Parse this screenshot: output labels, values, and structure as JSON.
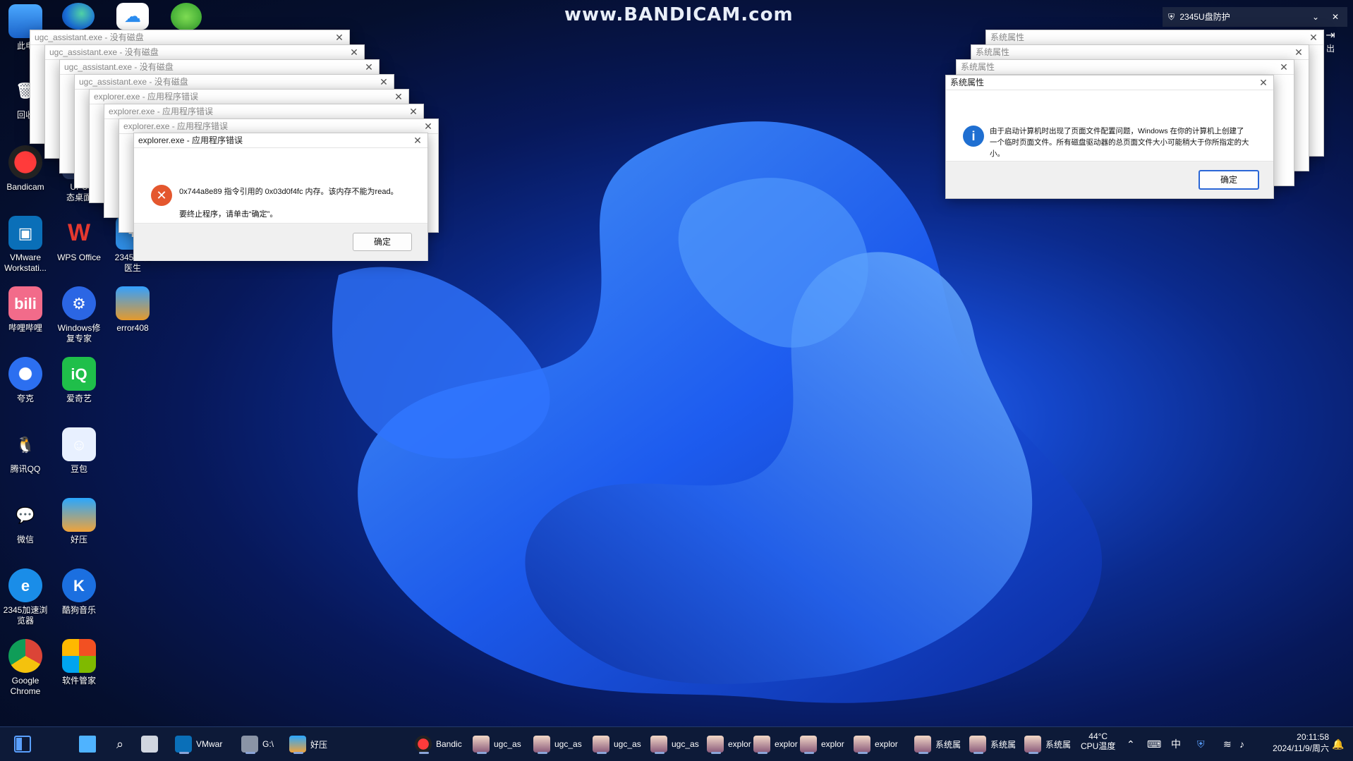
{
  "watermark": "www.BANDICAM.com",
  "colors": {
    "accent": "#2a66d6",
    "error_red": "#e4572e",
    "info_blue": "#1f6fd1",
    "taskbar": "#0d1a38"
  },
  "desktop": {
    "icons": [
      {
        "id": "this-pc",
        "label": "此电",
        "icon": "monitor-icon"
      },
      {
        "id": "recycle",
        "label": "回收",
        "icon": "recycle-bin-icon"
      },
      {
        "id": "bandicam",
        "label": "Bandicam",
        "icon": "record-icon"
      },
      {
        "id": "upupoo",
        "label": "UPU\n态桌面",
        "icon": "upupoo-icon"
      },
      {
        "id": "vmware",
        "label": "VMware\nWorkstati...",
        "icon": "vmware-icon"
      },
      {
        "id": "wps",
        "label": "WPS Office",
        "icon": "wps-icon"
      },
      {
        "id": "2345doctor",
        "label": "2345系统\n医生",
        "icon": "doctor-icon"
      },
      {
        "id": "bilibili",
        "label": "哔哩哔哩",
        "icon": "bilibili-icon"
      },
      {
        "id": "winrepair",
        "label": "Windows修\n复专家",
        "icon": "repair-icon"
      },
      {
        "id": "error408",
        "label": "error408",
        "icon": "archive-icon"
      },
      {
        "id": "quark",
        "label": "夸克",
        "icon": "quark-icon"
      },
      {
        "id": "iqiyi",
        "label": "爱奇艺",
        "icon": "iqiyi-icon"
      },
      {
        "id": "qq",
        "label": "腾讯QQ",
        "icon": "penguin-icon"
      },
      {
        "id": "doubao",
        "label": "豆包",
        "icon": "doubao-icon"
      },
      {
        "id": "wechat",
        "label": "微信",
        "icon": "wechat-icon"
      },
      {
        "id": "haozip",
        "label": "好压",
        "icon": "haozip-icon"
      },
      {
        "id": "2345browser",
        "label": "2345加速浏\n览器",
        "icon": "browser-e-icon"
      },
      {
        "id": "kugou",
        "label": "酷狗音乐",
        "icon": "kugou-icon"
      },
      {
        "id": "chrome",
        "label": "Google\nChrome",
        "icon": "chrome-icon"
      },
      {
        "id": "softmgr",
        "label": "软件管家",
        "icon": "softmgr-icon"
      }
    ],
    "top_icons": [
      "edge-icon",
      "cloud-icon",
      "green-app-icon"
    ]
  },
  "shield_popup": {
    "title": "2345U盘防护",
    "exit_label": "出"
  },
  "stacked_left": [
    "ugc_assistant.exe - 没有磁盘",
    "ugc_assistant.exe - 没有磁盘",
    "ugc_assistant.exe - 没有磁盘",
    "ugc_assistant.exe - 没有磁盘",
    "explorer.exe - 应用程序错误",
    "explorer.exe - 应用程序错误",
    "explorer.exe - 应用程序错误"
  ],
  "error_dialog": {
    "title": "explorer.exe - 应用程序错误",
    "line1": "0x744a8e89 指令引用的 0x03d0f4fc 内存。该内存不能为read。",
    "line2": "要终止程序，请单击“确定”。",
    "ok": "确定"
  },
  "stacked_right": [
    "系统属性",
    "系统属性",
    "系统属性"
  ],
  "sys_dialog": {
    "title": "系统属性",
    "message": "由于启动计算机时出现了页面文件配置问题，Windows 在你的计算机上创建了一个临时页面文件。所有磁盘驱动器的总页面文件大小可能稍大于你所指定的大小。",
    "ok": "确定"
  },
  "taskbar": {
    "items": [
      {
        "label": "",
        "icon": "windows-start-icon"
      },
      {
        "label": "",
        "icon": "search-icon"
      },
      {
        "label": "",
        "icon": "task-view-icon"
      },
      {
        "label": "VMwar",
        "icon": "vmware-icon"
      },
      {
        "label": "G:\\",
        "icon": "drive-icon"
      },
      {
        "label": "好压",
        "icon": "haozip-icon"
      },
      {
        "label": "Bandic",
        "icon": "record-icon"
      },
      {
        "label": "ugc_as",
        "icon": "anime-avatar-icon"
      },
      {
        "label": "ugc_as",
        "icon": "anime-avatar-icon"
      },
      {
        "label": "ugc_as",
        "icon": "anime-avatar-icon"
      },
      {
        "label": "ugc_as",
        "icon": "anime-avatar-icon"
      },
      {
        "label": "explor",
        "icon": "anime-avatar-icon"
      },
      {
        "label": "explor",
        "icon": "anime-avatar-icon"
      },
      {
        "label": "explor",
        "icon": "anime-avatar-icon"
      },
      {
        "label": "explor",
        "icon": "anime-avatar-icon"
      },
      {
        "label": "系统属",
        "icon": "anime-avatar-icon"
      },
      {
        "label": "系统属",
        "icon": "anime-avatar-icon"
      },
      {
        "label": "系统属",
        "icon": "anime-avatar-icon"
      }
    ],
    "cpu_temp": "44°C",
    "cpu_label": "CPU温度",
    "ime": "中",
    "time": "20:11:58",
    "date": "2024/11/9/周六"
  }
}
